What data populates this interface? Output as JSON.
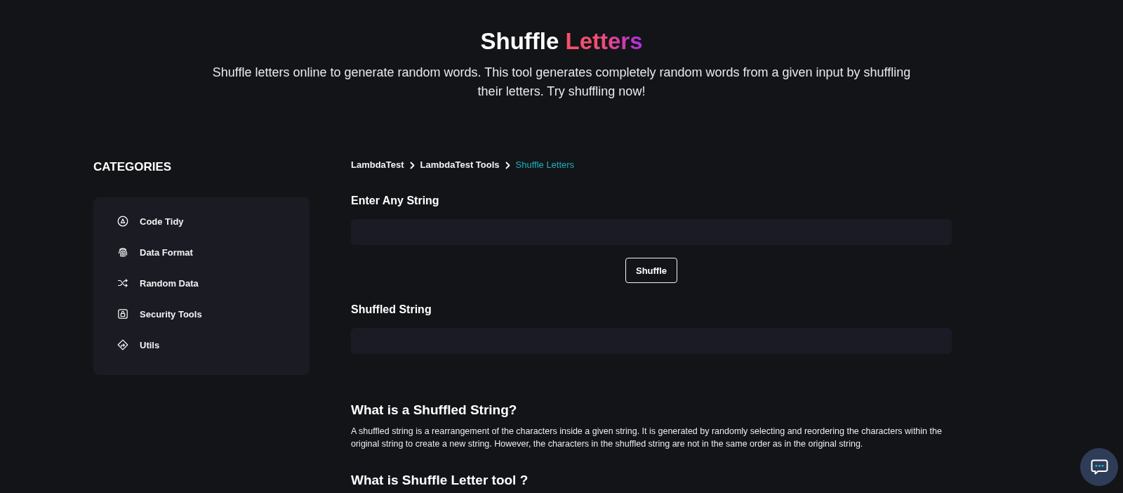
{
  "header": {
    "title": [
      {
        "text": "Shuffle",
        "kind": "plain"
      },
      {
        "text": "Letters",
        "kind": "gradient"
      }
    ],
    "subtitle": "Shuffle letters online to generate random words. This tool generates completely random words from a given input by shuffling their letters. Try shuffling now!"
  },
  "sidebar": {
    "heading": "CATEGORIES",
    "items": [
      {
        "label": "Code Tidy",
        "selected": false
      },
      {
        "label": "Data Format",
        "selected": false
      },
      {
        "label": "Random Data",
        "selected": false
      },
      {
        "label": "Security Tools",
        "selected": false
      },
      {
        "label": "Utils",
        "selected": false
      }
    ]
  },
  "breadcrumb": [
    {
      "label": "LambdaTest",
      "current": false
    },
    {
      "label": "LambdaTest Tools",
      "current": false
    },
    {
      "label": "Shuffle Letters",
      "current": true
    }
  ],
  "tool": {
    "input_label": "Enter Any String",
    "button": "Shuffle",
    "output_label": "Shuffled String"
  },
  "articles": [
    {
      "heading": "What is a Shuffled String?",
      "body": "A shuffled string is a rearrangement of the characters inside a given string. It is generated by randomly selecting and reordering the characters within the original string to create a new string. However, the characters in the shuffled string are not in the same order as in the original string."
    },
    {
      "heading": "What is Shuffle Letter tool ?"
    }
  ]
}
